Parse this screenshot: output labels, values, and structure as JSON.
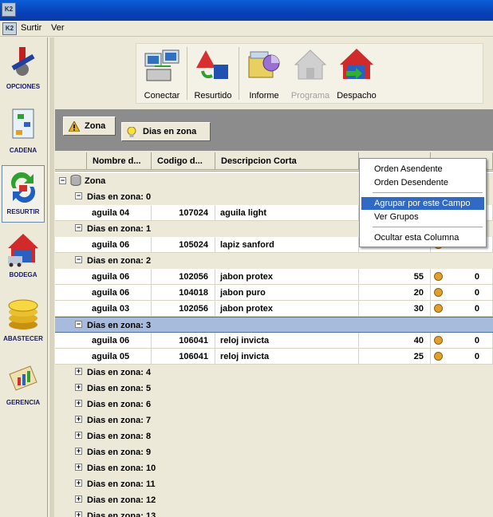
{
  "menu": {
    "surtir": "Surtir",
    "ver": "Ver"
  },
  "sidebar": [
    {
      "label": "OPCIONES",
      "icon": "options-tools-icon"
    },
    {
      "label": "CADENA",
      "icon": "chain-document-icon"
    },
    {
      "label": "RESURTIR",
      "icon": "resurtir-cycle-icon"
    },
    {
      "label": "BODEGA",
      "icon": "warehouse-house-icon"
    },
    {
      "label": "ABASTECER",
      "icon": "gold-coins-icon"
    },
    {
      "label": "GERENCIA",
      "icon": "management-chart-icon"
    }
  ],
  "toolbar": {
    "conectar": "Conectar",
    "resurtido": "Resurtido",
    "informe": "Informe",
    "programa": "Programa",
    "despacho": "Despacho"
  },
  "group_panel": {
    "chip1": "Zona",
    "chip2": "Dias en zona"
  },
  "columns": {
    "nombre": "Nombre d...",
    "codigo": "Codigo d...",
    "descripcion": "Descripcion Corta"
  },
  "tree": {
    "root": "Zona"
  },
  "groups": [
    {
      "label": "Dias en zona: 0",
      "expanded": true,
      "rows": [
        {
          "nombre": "aguila 04",
          "codigo": "107024",
          "desc": "aguila light",
          "cant": "",
          "extra": ""
        }
      ]
    },
    {
      "label": "Dias en zona: 1",
      "expanded": true,
      "rows": [
        {
          "nombre": "aguila 06",
          "codigo": "105024",
          "desc": "lapiz sanford",
          "cant": "",
          "extra": ""
        }
      ]
    },
    {
      "label": "Dias en zona: 2",
      "expanded": true,
      "rows": [
        {
          "nombre": "aguila 06",
          "codigo": "102056",
          "desc": "jabon protex",
          "cant": "55",
          "extra": "0"
        },
        {
          "nombre": "aguila 06",
          "codigo": "104018",
          "desc": "jabon puro",
          "cant": "20",
          "extra": "0"
        },
        {
          "nombre": "aguila 03",
          "codigo": "102056",
          "desc": "jabon protex",
          "cant": "30",
          "extra": "0"
        }
      ]
    },
    {
      "label": "Dias en zona: 3",
      "expanded": true,
      "selected": true,
      "rows": [
        {
          "nombre": "aguila 06",
          "codigo": "106041",
          "desc": "reloj invicta",
          "cant": "40",
          "extra": "0"
        },
        {
          "nombre": "aguila 05",
          "codigo": "106041",
          "desc": "reloj invicta",
          "cant": "25",
          "extra": "0"
        }
      ]
    },
    {
      "label": "Dias en zona: 4",
      "expanded": false,
      "rows": []
    },
    {
      "label": "Dias en zona: 5",
      "expanded": false,
      "rows": []
    },
    {
      "label": "Dias en zona: 6",
      "expanded": false,
      "rows": []
    },
    {
      "label": "Dias en zona: 7",
      "expanded": false,
      "rows": []
    },
    {
      "label": "Dias en zona: 8",
      "expanded": false,
      "rows": []
    },
    {
      "label": "Dias en zona: 9",
      "expanded": false,
      "rows": []
    },
    {
      "label": "Dias en zona: 10",
      "expanded": false,
      "rows": []
    },
    {
      "label": "Dias en zona: 11",
      "expanded": false,
      "rows": []
    },
    {
      "label": "Dias en zona: 12",
      "expanded": false,
      "rows": []
    },
    {
      "label": "Dias en zona: 13",
      "expanded": false,
      "rows": []
    }
  ],
  "context_menu": {
    "orden_asc": "Orden Asendente",
    "orden_desc": "Orden Desendente",
    "agrupar": "Agrupar por este Campo",
    "ver_grupos": "Ver Grupos",
    "ocultar": "Ocultar esta Columna"
  },
  "colors": {
    "selection": "#316ac5",
    "group_selected": "#a7bcdc",
    "titlebar": "#0a5fd8"
  }
}
